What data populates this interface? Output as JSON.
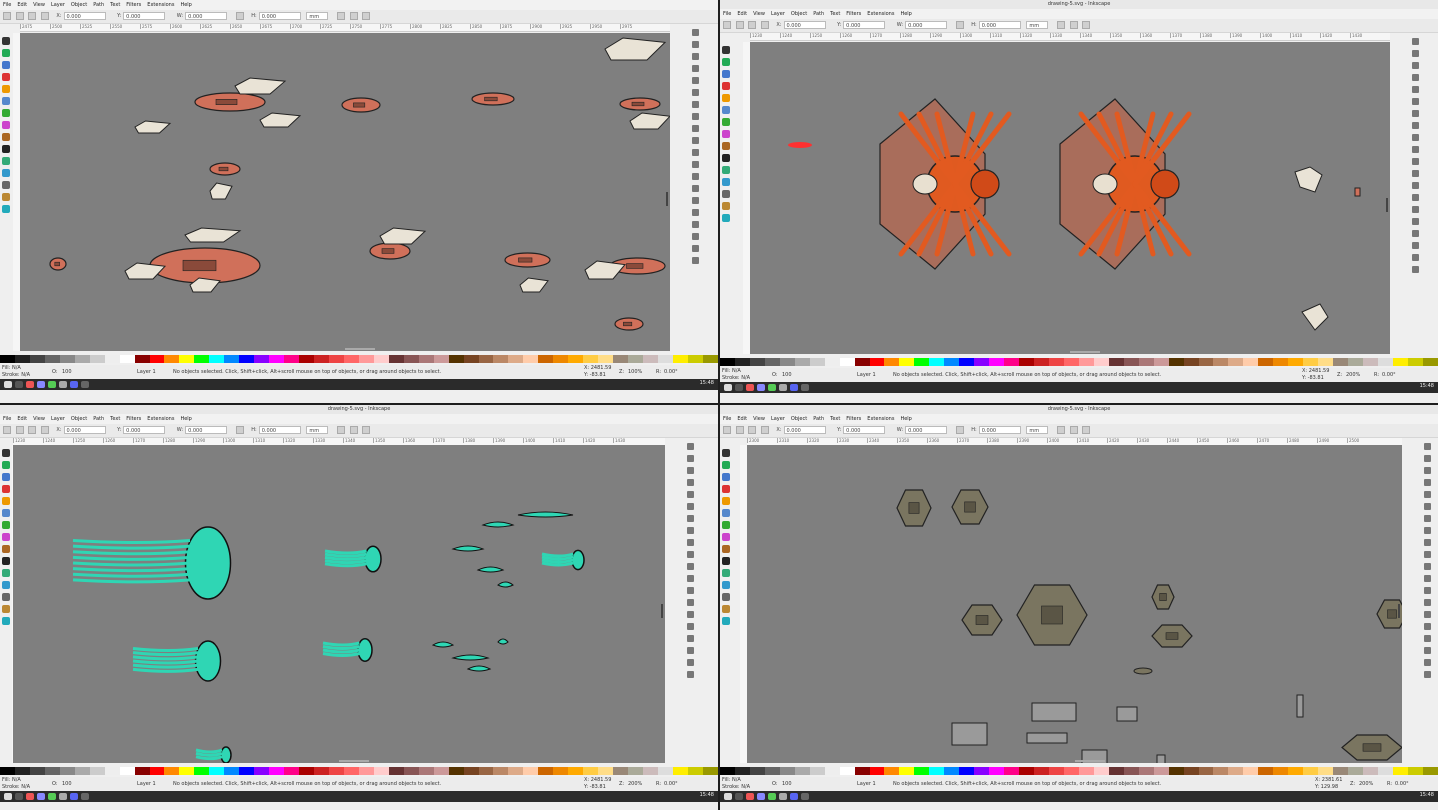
{
  "windows": [
    {
      "title": "",
      "menu": [
        "File",
        "Edit",
        "View",
        "Layer",
        "Object",
        "Path",
        "Text",
        "Filters",
        "Extensions",
        "Help"
      ],
      "toolbar": {
        "x_label": "X:",
        "x": "0.000",
        "y_label": "Y:",
        "y": "0.000",
        "w_label": "W:",
        "w": "0.000",
        "h_label": "H:",
        "h": "0.000",
        "unit": "mm"
      },
      "ruler": [
        "2475",
        "2500",
        "2525",
        "2550",
        "2575",
        "2600",
        "2625",
        "2650",
        "2675",
        "2700",
        "2725",
        "2750",
        "2775",
        "2800",
        "2825",
        "2850",
        "2875",
        "2900",
        "2925",
        "2950",
        "2975"
      ],
      "status": {
        "fill_label": "Fill:",
        "fill": "N/A",
        "stroke_label": "Stroke:",
        "stroke": "N/A",
        "opacity_label": "O:",
        "opacity": "100",
        "layer": "Layer 1",
        "message": "No objects selected. Click, Shift+click, Alt+scroll mouse on top of objects, or drag around objects to select.",
        "x_label": "X:",
        "x": "2481.59",
        "y_label": "Y:",
        "y": "-83.81",
        "zoom_label": "Z:",
        "zoom": "100%",
        "rot_label": "R:",
        "rot": "0.00°"
      },
      "clock": "15:48"
    },
    {
      "title": "drawing-5.svg - Inkscape",
      "menu": [
        "File",
        "Edit",
        "View",
        "Layer",
        "Object",
        "Path",
        "Text",
        "Filters",
        "Extensions",
        "Help"
      ],
      "toolbar": {
        "x_label": "X:",
        "x": "0.000",
        "y_label": "Y:",
        "y": "0.000",
        "w_label": "W:",
        "w": "0.000",
        "h_label": "H:",
        "h": "0.000",
        "unit": "mm"
      },
      "ruler": [
        "1230",
        "1240",
        "1250",
        "1260",
        "1270",
        "1280",
        "1290",
        "1300",
        "1310",
        "1320",
        "1330",
        "1340",
        "1350",
        "1360",
        "1370",
        "1380",
        "1390",
        "1400",
        "1410",
        "1420",
        "1430"
      ],
      "status": {
        "fill_label": "Fill:",
        "fill": "N/A",
        "stroke_label": "Stroke:",
        "stroke": "N/A",
        "opacity_label": "O:",
        "opacity": "100",
        "layer": "Layer 1",
        "message": "No objects selected. Click, Shift+click, Alt+scroll mouse on top of objects, or drag around objects to select.",
        "x_label": "X:",
        "x": "2481.59",
        "y_label": "Y:",
        "y": "-83.81",
        "zoom_label": "Z:",
        "zoom": "200%",
        "rot_label": "R:",
        "rot": "0.00°"
      },
      "clock": "15:48"
    },
    {
      "title": "drawing-5.svg - Inkscape",
      "menu": [
        "File",
        "Edit",
        "View",
        "Layer",
        "Object",
        "Path",
        "Text",
        "Filters",
        "Extensions",
        "Help"
      ],
      "toolbar": {
        "x_label": "X:",
        "x": "0.000",
        "y_label": "Y:",
        "y": "0.000",
        "w_label": "W:",
        "w": "0.000",
        "h_label": "H:",
        "h": "0.000",
        "unit": "mm"
      },
      "ruler": [
        "1230",
        "1240",
        "1250",
        "1260",
        "1270",
        "1280",
        "1290",
        "1300",
        "1310",
        "1320",
        "1330",
        "1340",
        "1350",
        "1360",
        "1370",
        "1380",
        "1390",
        "1400",
        "1410",
        "1420",
        "1430"
      ],
      "status": {
        "fill_label": "Fill:",
        "fill": "N/A",
        "stroke_label": "Stroke:",
        "stroke": "N/A",
        "opacity_label": "O:",
        "opacity": "100",
        "layer": "Layer 1",
        "message": "No objects selected. Click, Shift+click, Alt+scroll mouse on top of objects, or drag around objects to select.",
        "x_label": "X:",
        "x": "2481.59",
        "y_label": "Y:",
        "y": "-83.81",
        "zoom_label": "Z:",
        "zoom": "200%",
        "rot_label": "R:",
        "rot": "0.00°"
      },
      "clock": "15:48"
    },
    {
      "title": "drawing-5.svg - Inkscape",
      "menu": [
        "File",
        "Edit",
        "View",
        "Layer",
        "Object",
        "Path",
        "Text",
        "Filters",
        "Extensions",
        "Help"
      ],
      "toolbar": {
        "x_label": "X:",
        "x": "0.000",
        "y_label": "Y:",
        "y": "0.000",
        "w_label": "W:",
        "w": "0.000",
        "h_label": "H:",
        "h": "0.000",
        "unit": "mm"
      },
      "ruler": [
        "2300",
        "2310",
        "2320",
        "2330",
        "2340",
        "2350",
        "2360",
        "2370",
        "2380",
        "2390",
        "2400",
        "2410",
        "2420",
        "2430",
        "2440",
        "2450",
        "2460",
        "2470",
        "2480",
        "2490",
        "2500"
      ],
      "status": {
        "fill_label": "Fill:",
        "fill": "N/A",
        "stroke_label": "Stroke:",
        "stroke": "N/A",
        "opacity_label": "O:",
        "opacity": "100",
        "layer": "Layer 1",
        "message": "No objects selected. Click, Shift+click, Alt+scroll mouse on top of objects, or drag around objects to select.",
        "x_label": "X:",
        "x": "2381.61",
        "y_label": "Y:",
        "y": "129.98",
        "zoom_label": "Z:",
        "zoom": "200%",
        "rot_label": "R:",
        "rot": "0.00°"
      },
      "clock": "15:48"
    }
  ],
  "colors": {
    "canvas": "#7f7f7f",
    "ship": "#d0705a",
    "wreck": "#e9e3d6",
    "spider": "#e05a20",
    "jelly": "#2fd6b4",
    "mech": "#7a7560"
  }
}
